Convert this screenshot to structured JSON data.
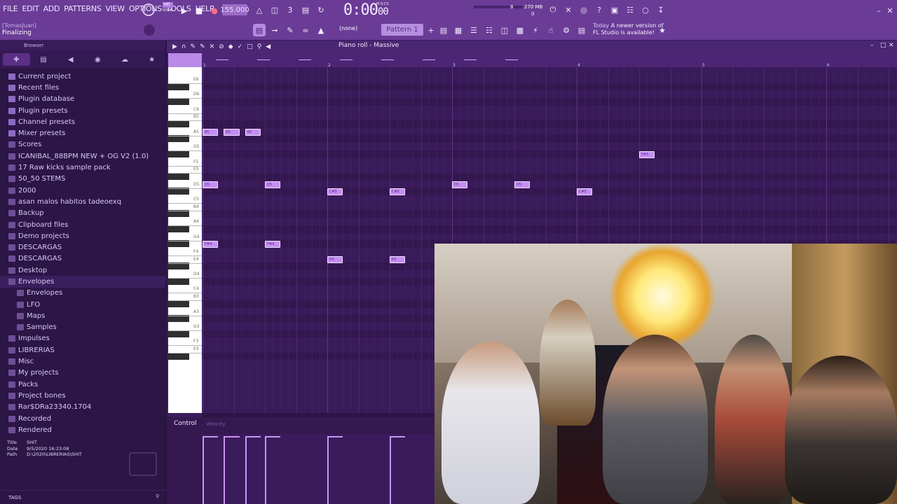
{
  "menu": [
    "FILE",
    "EDIT",
    "ADD",
    "PATTERNS",
    "VIEW",
    "OPTIONS",
    "TOOLS",
    "HELP"
  ],
  "transport": {
    "pat_label": "PAT",
    "song_label": "SONG",
    "tempo": "155.000",
    "time_main": "0:00",
    "time_sub": "00",
    "time_unit": "M:S:CS",
    "cpu_value": "8",
    "memory": "270 MB",
    "polyphony": "0"
  },
  "hint": {
    "user": "[TomasJuan]",
    "status": "Finalizing"
  },
  "pattern": {
    "none_selector": "(none)",
    "name": "Pattern 1"
  },
  "news": {
    "day": "Today",
    "text_line1": "A newer version of",
    "text_line2": "FL Studio is available!"
  },
  "browser": {
    "title": "Browser",
    "tabs": [
      "all",
      "files",
      "audio",
      "plugins",
      "cloud",
      "starred"
    ],
    "items": [
      {
        "label": "Current project",
        "level": 0
      },
      {
        "label": "Recent files",
        "level": 0
      },
      {
        "label": "Plugin database",
        "level": 0
      },
      {
        "label": "Plugin presets",
        "level": 0
      },
      {
        "label": "Channel presets",
        "level": 0
      },
      {
        "label": "Mixer presets",
        "level": 0
      },
      {
        "label": "Scores",
        "level": 0
      },
      {
        "label": "ICANIBAL_88BPM NEW + OG V2 (1.0)",
        "level": 0
      },
      {
        "label": "17 Raw kicks sample pack",
        "level": 0
      },
      {
        "label": "50_50 STEMS",
        "level": 0
      },
      {
        "label": "2000",
        "level": 0
      },
      {
        "label": "asan malos habitos tadeoexq",
        "level": 0
      },
      {
        "label": "Backup",
        "level": 0
      },
      {
        "label": "Clipboard files",
        "level": 0
      },
      {
        "label": "Demo projects",
        "level": 0
      },
      {
        "label": "DESCARGAS",
        "level": 0
      },
      {
        "label": "DESCARGAS",
        "level": 0
      },
      {
        "label": "Desktop",
        "level": 0
      },
      {
        "label": "Envelopes",
        "level": 0
      },
      {
        "label": "Envelopes",
        "level": 1
      },
      {
        "label": "LFO",
        "level": 1
      },
      {
        "label": "Maps",
        "level": 1
      },
      {
        "label": "Samples",
        "level": 1
      },
      {
        "label": "Impulses",
        "level": 0
      },
      {
        "label": "LIBRERIAS",
        "level": 0
      },
      {
        "label": "Misc",
        "level": 0
      },
      {
        "label": "My projects",
        "level": 0
      },
      {
        "label": "Packs",
        "level": 0
      },
      {
        "label": "Project bones",
        "level": 0
      },
      {
        "label": "Rar$DRa23340.1704",
        "level": 0
      },
      {
        "label": "Recorded",
        "level": 0
      },
      {
        "label": "Rendered",
        "level": 0
      }
    ],
    "file_info": {
      "title_key": "Title",
      "title_val": "SHIT",
      "date_key": "Date",
      "date_val": "9/5/2020 16:23:08",
      "path_key": "Path",
      "path_val": "D:\\2020\\LIBRERIAS\\SHIT"
    },
    "tags_label": "TAGS"
  },
  "piano_roll": {
    "title": "Piano roll - Massive",
    "bar_numbers": [
      "1",
      "2",
      "3",
      "4",
      "5",
      "6"
    ],
    "key_labels": [
      "E6",
      "D6",
      "C6",
      "B5",
      "A5",
      "G5",
      "F5",
      "E5",
      "D5",
      "C5",
      "B4",
      "A4",
      "G4",
      "F4",
      "E4",
      "D4",
      "C4",
      "B3",
      "A3",
      "G3",
      "F3",
      "E3"
    ],
    "notes": [
      {
        "label": "A5",
        "pitch": "A5",
        "start": 1.0,
        "length": 0.125
      },
      {
        "label": "A5",
        "pitch": "A5",
        "start": 1.17,
        "length": 0.125
      },
      {
        "label": "A5",
        "pitch": "A5",
        "start": 1.34,
        "length": 0.125
      },
      {
        "label": "D5",
        "pitch": "D5",
        "start": 1.0,
        "length": 0.125
      },
      {
        "label": "D5",
        "pitch": "D5",
        "start": 1.5,
        "length": 0.125
      },
      {
        "label": "C#5",
        "pitch": "C#5",
        "start": 2.0,
        "length": 0.125
      },
      {
        "label": "C#5",
        "pitch": "C#5",
        "start": 2.5,
        "length": 0.125
      },
      {
        "label": "D5",
        "pitch": "D5",
        "start": 3.0,
        "length": 0.125
      },
      {
        "label": "D5",
        "pitch": "D5",
        "start": 3.5,
        "length": 0.125
      },
      {
        "label": "C#5",
        "pitch": "C#5",
        "start": 4.0,
        "length": 0.125
      },
      {
        "label": "F#5",
        "pitch": "F#5",
        "start": 4.5,
        "length": 0.125
      },
      {
        "label": "F#4",
        "pitch": "F#4",
        "start": 1.0,
        "length": 0.125
      },
      {
        "label": "F#4",
        "pitch": "F#4",
        "start": 1.5,
        "length": 0.125
      },
      {
        "label": "E4",
        "pitch": "E4",
        "start": 2.0,
        "length": 0.125
      },
      {
        "label": "E4",
        "pitch": "E4",
        "start": 2.5,
        "length": 0.125
      }
    ],
    "control_label": "Control",
    "velocity_label": "Velocity",
    "velocity_hits": [
      1.0,
      1.17,
      1.34,
      1.5,
      2.0,
      2.5
    ]
  }
}
